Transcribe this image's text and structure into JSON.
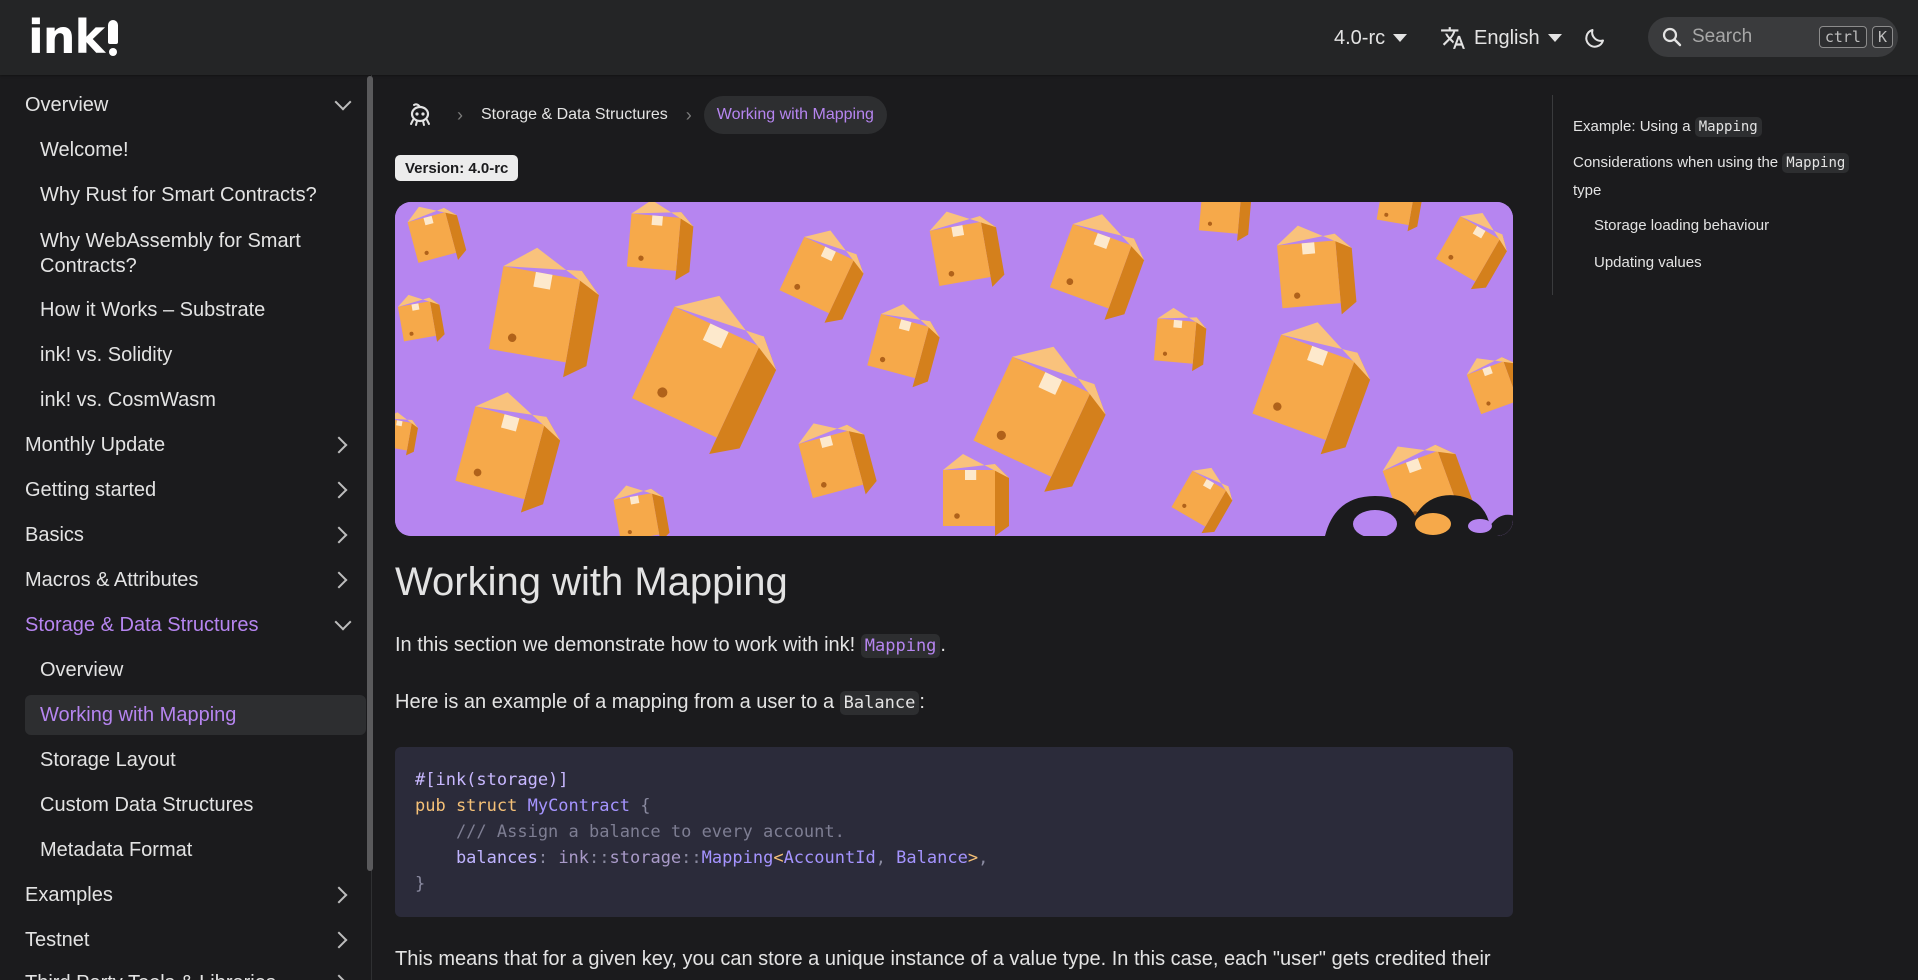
{
  "navbar": {
    "logo_text": "ink",
    "version": "4.0-rc",
    "language": "English",
    "search_label": "Search",
    "kbd_ctrl": "ctrl",
    "kbd_k": "K"
  },
  "sidebar": {
    "items": [
      {
        "label": "Overview",
        "kind": "category",
        "expanded": true
      },
      {
        "label": "Welcome!",
        "kind": "sub"
      },
      {
        "label": "Why Rust for Smart Contracts?",
        "kind": "sub"
      },
      {
        "label": "Why WebAssembly for Smart Contracts?",
        "kind": "sub"
      },
      {
        "label": "How it Works – Substrate",
        "kind": "sub"
      },
      {
        "label": "ink! vs. Solidity",
        "kind": "sub"
      },
      {
        "label": "ink! vs. CosmWasm",
        "kind": "sub"
      },
      {
        "label": "Monthly Update",
        "kind": "category"
      },
      {
        "label": "Getting started",
        "kind": "category"
      },
      {
        "label": "Basics",
        "kind": "category"
      },
      {
        "label": "Macros & Attributes",
        "kind": "category"
      },
      {
        "label": "Storage & Data Structures",
        "kind": "category",
        "expanded": true,
        "active": true
      },
      {
        "label": "Overview",
        "kind": "sub"
      },
      {
        "label": "Working with Mapping",
        "kind": "sub",
        "active": true
      },
      {
        "label": "Storage Layout",
        "kind": "sub"
      },
      {
        "label": "Custom Data Structures",
        "kind": "sub"
      },
      {
        "label": "Metadata Format",
        "kind": "sub"
      },
      {
        "label": "Examples",
        "kind": "category"
      },
      {
        "label": "Testnet",
        "kind": "category"
      },
      {
        "label": "Third Party Tools & Libraries",
        "kind": "category"
      }
    ]
  },
  "breadcrumbs": {
    "home_icon": "ink-squid-icon",
    "parent": "Storage & Data Structures",
    "current": "Working with Mapping"
  },
  "badge": "Version: 4.0-rc",
  "article": {
    "title": "Working with Mapping",
    "p1_before": "In this section we demonstrate how to work with ink! ",
    "p1_code": "Mapping",
    "p1_after": ".",
    "p2_before": "Here is an example of a mapping from a user to a ",
    "p2_code": "Balance",
    "p2_after": ":",
    "code_lines": [
      "#[ink(storage)]",
      "pub struct MyContract {",
      "    /// Assign a balance to every account.",
      "    balances: ink::storage::Mapping<AccountId, Balance>,",
      "}"
    ],
    "p3": "This means that for a given key, you can store a unique instance of a value type. In this case, each \"user\" gets credited their"
  },
  "toc": {
    "item1_before": "Example: Using a ",
    "item1_code": "Mapping",
    "item2_before": "Considerations when using the ",
    "item2_code": "Mapping",
    "item2_after": "type",
    "item3": "Storage loading behaviour",
    "item4": "Updating values"
  },
  "colors": {
    "accent": "#b685f0",
    "hero_bg": "#b685f0",
    "box": "#f6a94a"
  }
}
